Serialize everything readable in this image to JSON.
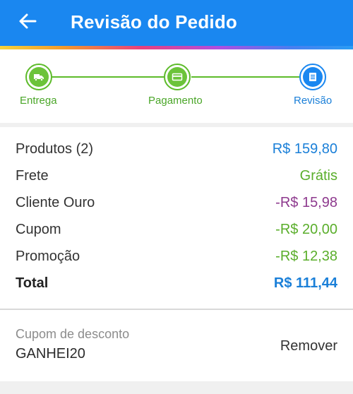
{
  "header": {
    "title": "Revisão do Pedido",
    "background": "#1a87f0"
  },
  "stepper": {
    "steps": [
      {
        "label": "Entrega",
        "state": "done",
        "icon": "truck-icon",
        "color": "#5dbb2a"
      },
      {
        "label": "Pagamento",
        "state": "done",
        "icon": "credit-card-icon",
        "color": "#5dbb2a"
      },
      {
        "label": "Revisão",
        "state": "current",
        "icon": "document-icon",
        "color": "#1a87f0"
      }
    ]
  },
  "summary": {
    "rows": [
      {
        "label": "Produtos (2)",
        "value": "R$ 159,80",
        "color": "#1a7fd8"
      },
      {
        "label": "Frete",
        "value": "Grátis",
        "color": "#5aae2b"
      },
      {
        "label": "Cliente Ouro",
        "value": "-R$ 15,98",
        "color": "#8e3a8e"
      },
      {
        "label": "Cupom",
        "value": "-R$ 20,00",
        "color": "#5aae2b"
      },
      {
        "label": "Promoção",
        "value": "-R$ 12,38",
        "color": "#5aae2b"
      }
    ],
    "total": {
      "label": "Total",
      "value": "R$ 111,44",
      "color": "#1a7fd8"
    }
  },
  "coupon": {
    "caption": "Cupom de desconto",
    "code": "GANHEI20",
    "remove_label": "Remover"
  }
}
